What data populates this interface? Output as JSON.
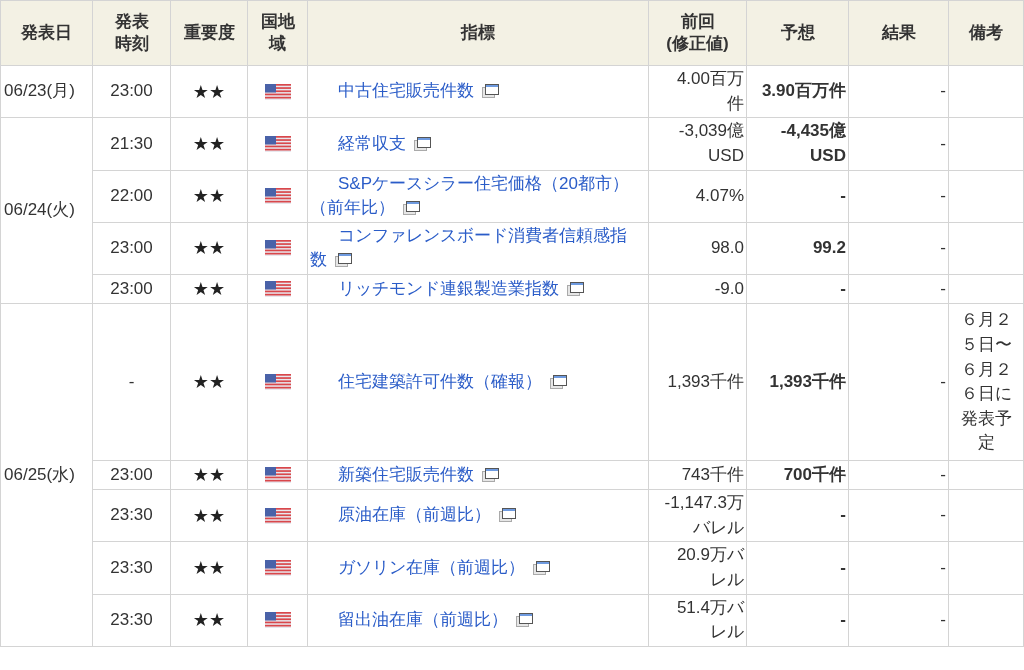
{
  "table": {
    "columns": [
      "発表日",
      "発表時刻",
      "重要度",
      "国地域",
      "指標",
      "前回(修正値)",
      "予想",
      "結果",
      "備考"
    ],
    "days": [
      {
        "date": "06/23(月)",
        "events": [
          {
            "time": "23:00",
            "importance": "★★",
            "indicator": "中古住宅販売件数",
            "previous": "4.00百万件",
            "forecast": "3.90百万件",
            "result": "-"
          }
        ]
      },
      {
        "date": "06/24(火)",
        "events": [
          {
            "time": "21:30",
            "importance": "★★",
            "indicator": "経常収支",
            "previous": "-3,039億USD",
            "forecast": "-4,435億USD",
            "result": "-"
          },
          {
            "time": "22:00",
            "importance": "★★",
            "indicator": "S&Pケースシラー住宅価格（20都市）（前年比）",
            "previous": "4.07%",
            "forecast": "-",
            "result": "-"
          },
          {
            "time": "23:00",
            "importance": "★★",
            "indicator": "コンファレンスボード消費者信頼感指数",
            "previous": "98.0",
            "forecast": "99.2",
            "result": "-"
          },
          {
            "time": "23:00",
            "importance": "★★",
            "indicator": "リッチモンド連銀製造業指数",
            "previous": "-9.0",
            "forecast": "-",
            "result": "-"
          }
        ]
      },
      {
        "date": "06/25(水)",
        "events": [
          {
            "time": "-",
            "importance": "★★",
            "indicator": "住宅建築許可件数（確報）",
            "previous": "1,393千件",
            "forecast": "1,393千件",
            "result": "-",
            "note": "６月２５日〜６月２６日に発表予定"
          },
          {
            "time": "23:00",
            "importance": "★★",
            "indicator": "新築住宅販売件数",
            "previous": "743千件",
            "forecast": "700千件",
            "result": "-"
          },
          {
            "time": "23:30",
            "importance": "★★",
            "indicator": "原油在庫（前週比）",
            "previous": "-1,147.3万バレル",
            "forecast": "-",
            "result": "-"
          },
          {
            "time": "23:30",
            "importance": "★★",
            "indicator": "ガソリン在庫（前週比）",
            "previous": "20.9万バレル",
            "forecast": "-",
            "result": "-"
          },
          {
            "time": "23:30",
            "importance": "★★",
            "indicator": "留出油在庫（前週比）",
            "previous": "51.4万バレル",
            "forecast": "-",
            "result": "-"
          }
        ]
      }
    ]
  }
}
